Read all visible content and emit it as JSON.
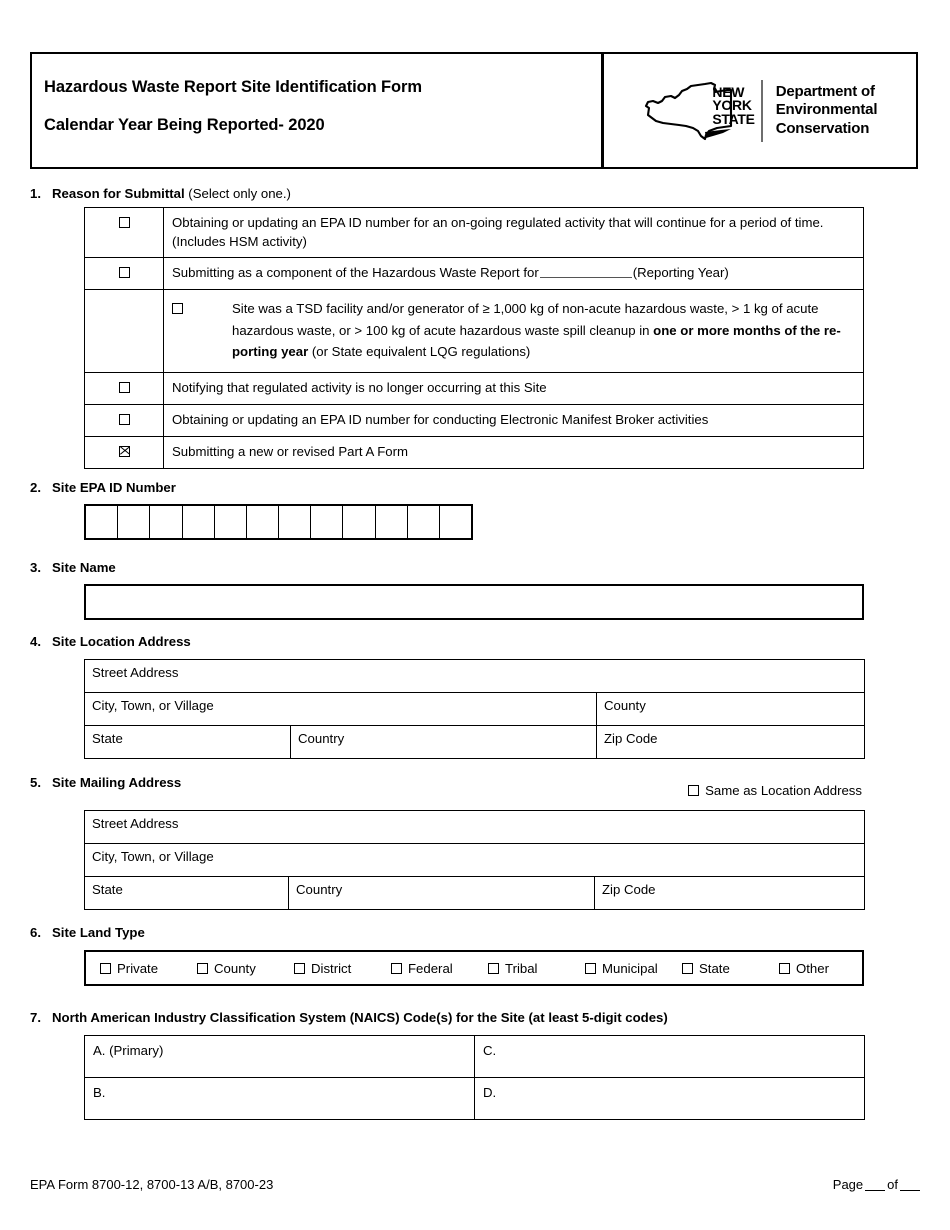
{
  "header": {
    "title": "Hazardous Waste Report Site Identification Form",
    "subtitle": "Calendar Year Being Reported- 2020",
    "logo": {
      "state_line1": "NEW",
      "state_line2": "YORK",
      "state_line3": "STATE",
      "agency_line1": "Department of",
      "agency_line2": "Environmental",
      "agency_line3": "Conservation"
    }
  },
  "sections": {
    "reason": {
      "number": "1.",
      "title": "Reason for Submittal",
      "note": "(Select only one.)",
      "rows": [
        {
          "checked": false,
          "indented": false,
          "text": "Obtaining or updating an EPA ID number for an on-going regulated activity that will continue for a period of time. (Includes HSM activity)"
        },
        {
          "checked": false,
          "indented": false,
          "text_pre": "Submitting as a component of the Hazardous Waste Report  for",
          "text_post": "(Reporting Year)"
        },
        {
          "checked": false,
          "indented": true,
          "text_a": "Site was a TSD facility and/or generator of ≥ 1,000 kg of non-acute hazardous waste, > 1 kg of acute hazardous waste, or > 100 kg of acute hazardous waste spill cleanup in ",
          "text_bold": "one or more months of the re-porting year",
          "text_b": " (or State equivalent LQG regulations)"
        },
        {
          "checked": false,
          "indented": false,
          "text": "Notifying that regulated activity is no longer occurring at this Site"
        },
        {
          "checked": false,
          "indented": false,
          "text": "Obtaining or updating an EPA ID number for conducting Electronic Manifest Broker activities"
        },
        {
          "checked": true,
          "indented": false,
          "text": "Submitting a new or revised Part A Form"
        }
      ]
    },
    "epa_id": {
      "number": "2.",
      "title": "Site EPA ID Number",
      "cell_count": 12,
      "value": ""
    },
    "site_name": {
      "number": "3.",
      "title": "Site Name",
      "value": ""
    },
    "location_address": {
      "number": "4.",
      "title": "Site Location Address",
      "street_label": "Street Address",
      "city_label": "City, Town, or Village",
      "county_label": "County",
      "state_label": "State",
      "country_label": "Country",
      "zip_label": "Zip Code"
    },
    "mailing_address": {
      "number": "5.",
      "title": "Site Mailing Address",
      "same_as_label": "Same as Location Address",
      "same_as_checked": false,
      "street_label": "Street Address",
      "city_label": "City, Town, or Village",
      "state_label": "State",
      "country_label": "Country",
      "zip_label": "Zip Code"
    },
    "land_type": {
      "number": "6.",
      "title": "Site Land Type",
      "options": [
        {
          "label": "Private",
          "checked": false
        },
        {
          "label": "County",
          "checked": false
        },
        {
          "label": "District",
          "checked": false
        },
        {
          "label": "Federal",
          "checked": false
        },
        {
          "label": "Tribal",
          "checked": false
        },
        {
          "label": "Municipal",
          "checked": false
        },
        {
          "label": "State",
          "checked": false
        },
        {
          "label": "Other",
          "checked": false
        }
      ]
    },
    "naics": {
      "number": "7.",
      "title": "North American Industry Classification System (NAICS) Code(s) for the Site (at least 5-digit codes)",
      "cell_a": "A.   (Primary)",
      "cell_b": "B.",
      "cell_c": "C.",
      "cell_d": "D."
    }
  },
  "footer": {
    "form_ids": "EPA Form 8700-12, 8700-13 A/B, 8700-23",
    "page_label_pre": "Page",
    "page_label_mid": "of",
    "page_number": "",
    "page_total": ""
  }
}
